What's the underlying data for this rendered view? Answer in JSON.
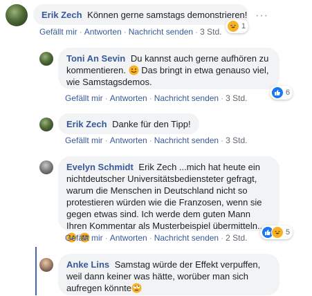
{
  "comments": [
    {
      "author": "Erik Zech",
      "text": " Können gerne samstags demonstrieren!",
      "actions": [
        "Gefällt mir",
        "Antworten",
        "Nachricht senden"
      ],
      "time": "3 Std.",
      "reaction_count": "1",
      "reactions": [
        "haha"
      ]
    },
    {
      "author": "Toni An Sevin",
      "text_part1": " Du kannst auch gerne aufhören zu kommentieren. ",
      "text_part2": " Das bringt in etwa genauso viel, wie Samstagsdemos.",
      "actions": [
        "Gefällt mir",
        "Antworten",
        "Nachricht senden"
      ],
      "time": "3 Std.",
      "reaction_count": "6",
      "reactions": [
        "like"
      ]
    },
    {
      "author": "Erik Zech",
      "text": " Danke für den Tipp!",
      "actions": [
        "Gefällt mir",
        "Antworten",
        "Nachricht senden"
      ],
      "time": "3 Std."
    },
    {
      "author": "Evelyn Schmidt",
      "text": " Erik Zech ...mich hat heute ein nichtdeutscher Universitätsbediensteter gefragt, warum die Menschen in Deutschland nicht so protestieren würden wie die Franzosen, wenn sie gegen etwas sind. Ich werde dem guten Mann Ihren Kommentar als Musterbeispiel übermitteln... ",
      "actions": [
        "Gefällt mir",
        "Antworten",
        "Nachricht senden"
      ],
      "time": "2 Std.",
      "reaction_count": "5",
      "reactions": [
        "like",
        "haha"
      ]
    },
    {
      "author": "Anke Lins",
      "text": " Samstag würde der Effekt verpuffen, weil dann keiner was hätte, worüber man sich aufregen könnte"
    }
  ],
  "separator": "·",
  "more_menu": "···",
  "colors": {
    "link": "#385898",
    "bubble": "#f2f3f5",
    "like": "#1877f2",
    "haha": "#f7b125"
  }
}
